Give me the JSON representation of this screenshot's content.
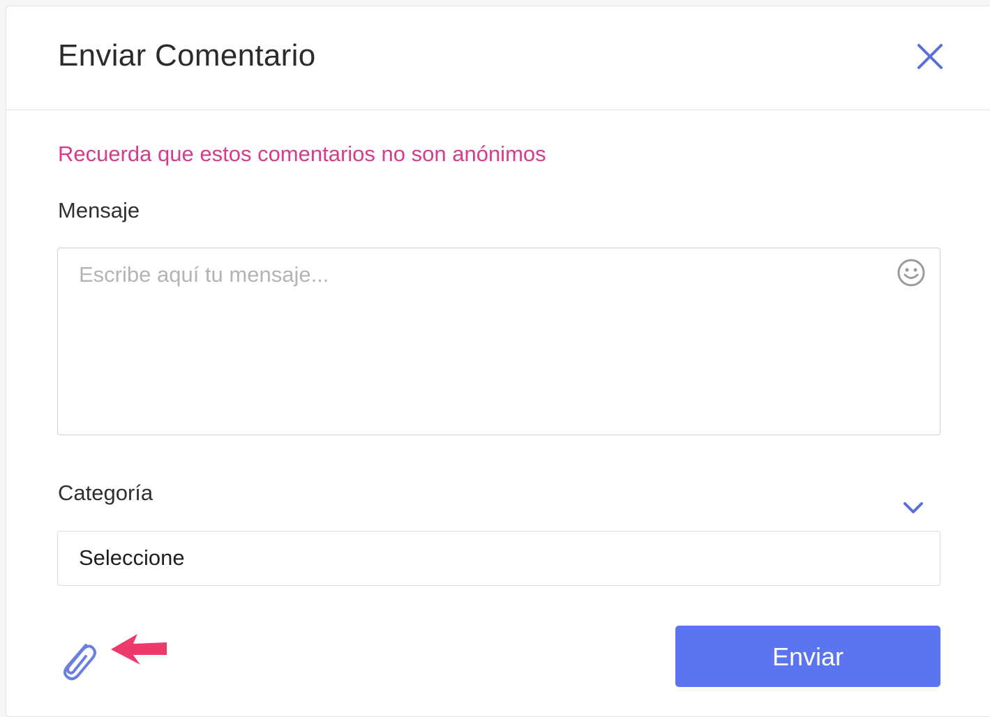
{
  "modal": {
    "title": "Enviar Comentario",
    "notice": "Recuerda que estos comentarios no son anónimos",
    "message": {
      "label": "Mensaje",
      "placeholder": "Escribe aquí tu mensaje...",
      "value": ""
    },
    "category": {
      "label": "Categoría",
      "selected": "Seleccione"
    },
    "send_label": "Enviar"
  },
  "icons": {
    "close": "close-icon",
    "emoji": "smiley-icon",
    "chevron": "chevron-down-icon",
    "attach": "paperclip-icon",
    "annotation": "arrow-left-icon"
  },
  "colors": {
    "accent": "#5a75ef",
    "notice": "#d63b8f",
    "annotation_arrow": "#ee3a6b"
  }
}
